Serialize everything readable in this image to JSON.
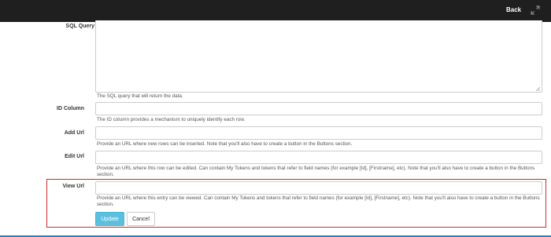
{
  "header": {
    "back_label": "Back",
    "expand_icon": "expand-arrows-icon"
  },
  "form": {
    "sql_query": {
      "label": "SQL Query",
      "value": "",
      "help": "The SQL query that will return the data."
    },
    "id_column": {
      "label": "ID Column",
      "value": "",
      "help": "The ID column provides a mechanism to uniquely identify each row."
    },
    "add_url": {
      "label": "Add Url",
      "value": "",
      "help": "Provide an URL where new rows can be inserted. Note that you'll also have to create a button in the Buttons section."
    },
    "edit_url": {
      "label": "Edit Url",
      "value": "",
      "help": "Provide an URL where this row can be edited. Can contain My Tokens and tokens that refer to field names (for example [Id], [Firstname], etc). Note that you'll also have to create a button in the Buttons section."
    },
    "view_url": {
      "label": "View Url",
      "value": "",
      "help": "Provide an URL where this entry can be viewed. Can contain My Tokens and tokens that refer to field names (for example [Id], [Firstname], etc). Note that you'll also have to create a button in the Buttons section."
    }
  },
  "actions": {
    "update_label": "Update",
    "cancel_label": "Cancel"
  },
  "colors": {
    "topbar": "#1f1f1f",
    "update_button": "#5bc0de",
    "highlight_border": "#cc2a2a",
    "bottom_accent": "#2f7dbd"
  }
}
